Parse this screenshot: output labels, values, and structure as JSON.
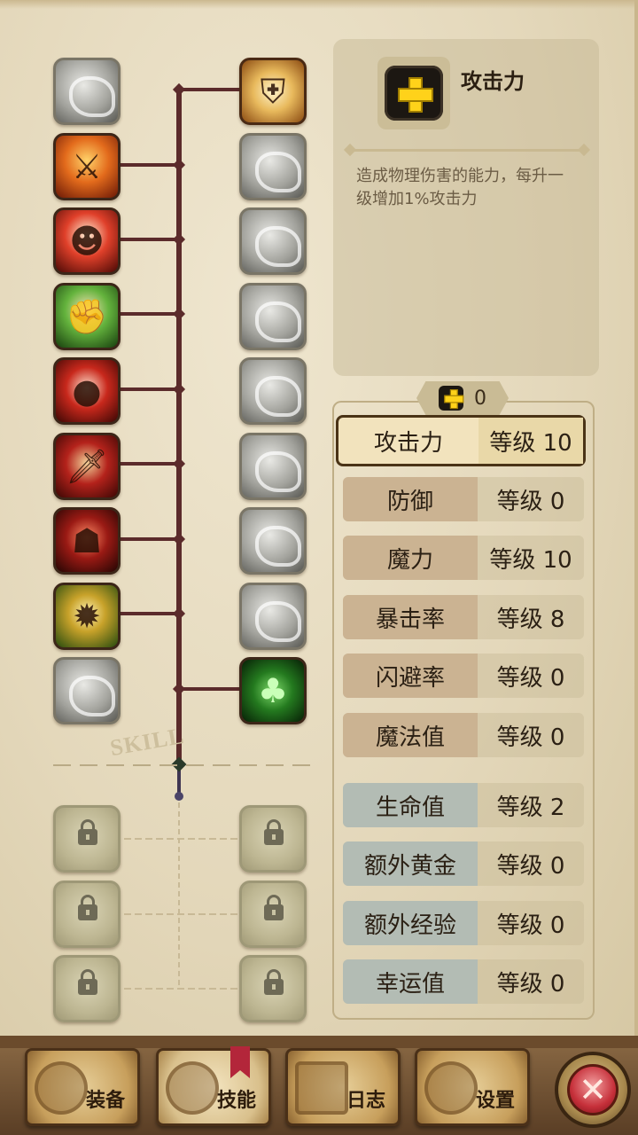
{
  "skill_tree": {
    "watermark": "SKILL",
    "left_column_icons": [
      "slash-skill-icon",
      "flame-slash-icon",
      "rage-roar-icon",
      "flex-strength-icon",
      "blood-strike-icon",
      "dagger-icon",
      "shadow-assassin-icon",
      "fire-burst-icon",
      "cross-blades-icon"
    ],
    "right_column_icons": [
      "holy-shield-icon",
      "grasp-icon",
      "lightning-icon",
      "tumble-icon",
      "whirlwind-icon",
      "eye-icon",
      "swift-strike-icon",
      "bubble-icon",
      "lucky-clover-icon"
    ],
    "locked_left_icons": [
      "locked-armor-icon",
      "locked-armor-icon",
      "locked-armor-icon"
    ],
    "locked_right_icons": [
      "locked-eye-icon",
      "locked-eye-icon",
      "locked-clover-icon"
    ]
  },
  "detail": {
    "icon": "yellow-plus-icon",
    "title": "攻击力",
    "description": "造成物理伤害的能力，每升一级增加1%攻击力"
  },
  "points": {
    "icon": "yellow-plus-icon",
    "value": "0"
  },
  "stats": [
    {
      "label": "攻击力",
      "level": "等级 10",
      "group": "combat",
      "selected": true
    },
    {
      "label": "防御",
      "level": "等级 0",
      "group": "combat",
      "selected": false
    },
    {
      "label": "魔力",
      "level": "等级 10",
      "group": "combat",
      "selected": false
    },
    {
      "label": "暴击率",
      "level": "等级 8",
      "group": "combat",
      "selected": false
    },
    {
      "label": "闪避率",
      "level": "等级 0",
      "group": "combat",
      "selected": false
    },
    {
      "label": "魔法值",
      "level": "等级 0",
      "group": "combat",
      "selected": false
    },
    {
      "label": "生命值",
      "level": "等级 2",
      "group": "util",
      "selected": false
    },
    {
      "label": "额外黄金",
      "level": "等级 0",
      "group": "util",
      "selected": false
    },
    {
      "label": "额外经验",
      "level": "等级 0",
      "group": "util",
      "selected": false
    },
    {
      "label": "幸运值",
      "level": "等级 0",
      "group": "util",
      "selected": false
    }
  ],
  "bottom_tabs": [
    {
      "label": "装备",
      "icon": "axe-icon",
      "active": false
    },
    {
      "label": "技能",
      "icon": "skill-rune-icon",
      "active": true
    },
    {
      "label": "日志",
      "icon": "journal-icon",
      "active": false
    },
    {
      "label": "设置",
      "icon": "gear-icon",
      "active": false
    }
  ],
  "close_button": {
    "icon": "close-icon",
    "glyph": "✕"
  },
  "colors": {
    "accent_yellow": "#ffd21a",
    "branch": "#5b2b2b",
    "selected_border": "#4a3316",
    "close_red": "#c6303a"
  }
}
